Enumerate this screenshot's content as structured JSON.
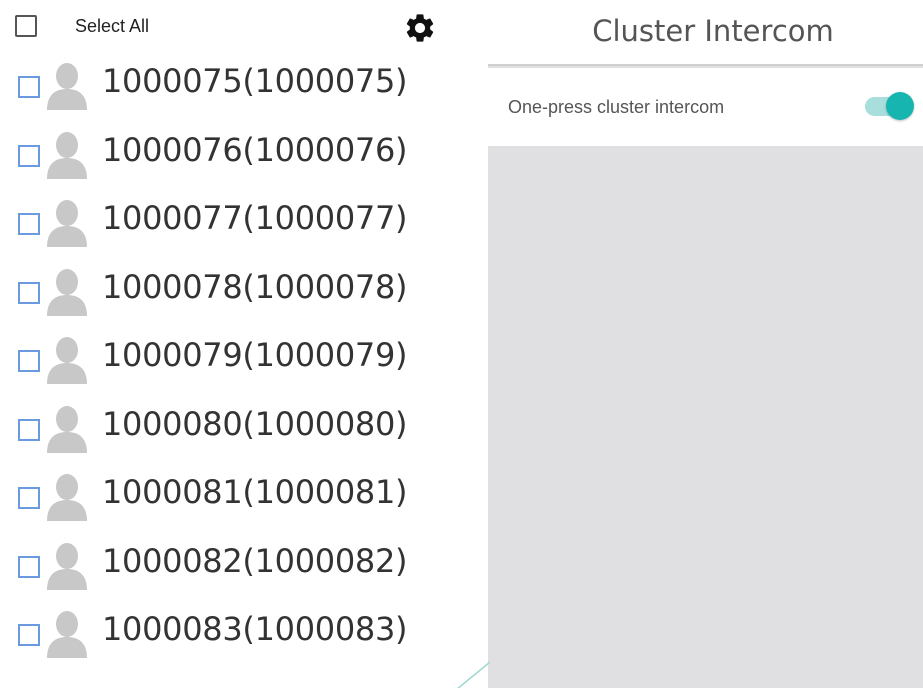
{
  "left_panel": {
    "select_all_label": "Select All",
    "settings_icon": "gear-icon",
    "members": [
      {
        "label": "1000075(1000075)"
      },
      {
        "label": "1000076(1000076)"
      },
      {
        "label": "1000077(1000077)"
      },
      {
        "label": "1000078(1000078)"
      },
      {
        "label": "1000079(1000079)"
      },
      {
        "label": "1000080(1000080)"
      },
      {
        "label": "1000081(1000081)"
      },
      {
        "label": "1000082(1000082)"
      },
      {
        "label": "1000083(1000083)"
      }
    ]
  },
  "right_panel": {
    "title": "Cluster Intercom",
    "setting_label": "One-press cluster intercom",
    "toggle_on": true
  },
  "colors": {
    "checkbox_border": "#6a9be0",
    "toggle_accent": "#16b5b0",
    "toggle_track": "#a8dedb",
    "panel_background": "#e0e0e2"
  }
}
